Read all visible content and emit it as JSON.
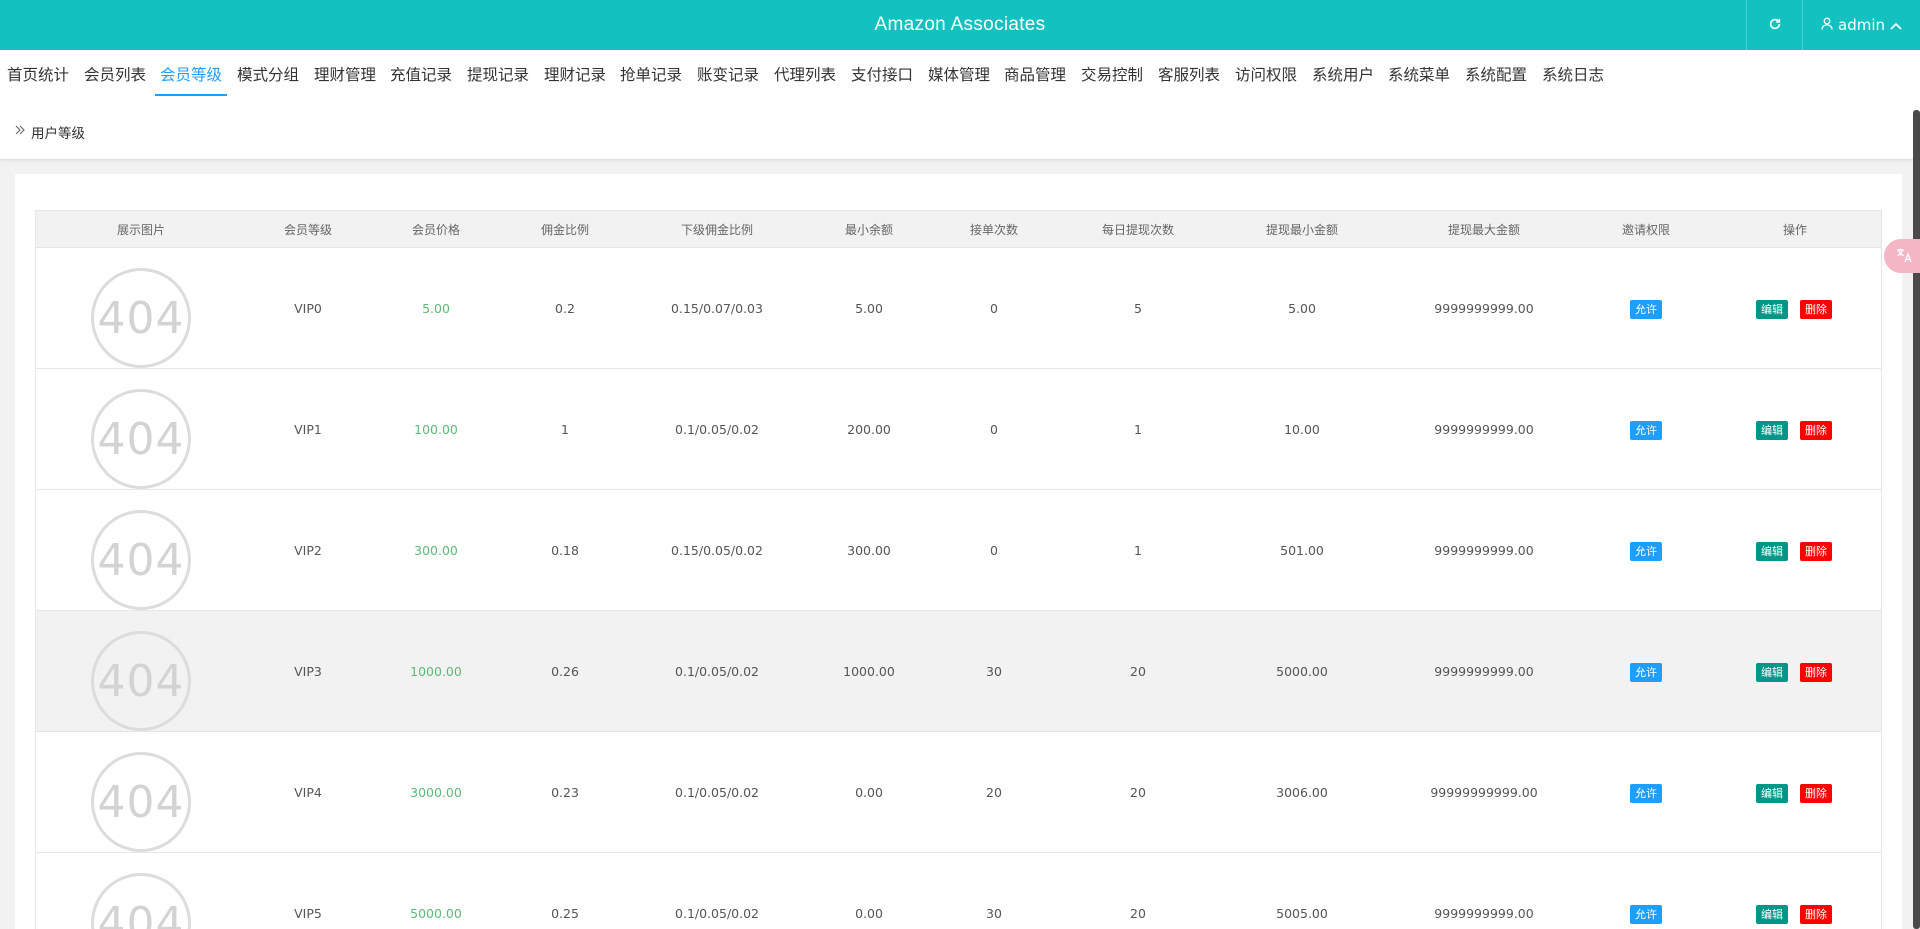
{
  "header": {
    "title": "Amazon Associates",
    "user": "admin",
    "brand_color": "#13c1c1"
  },
  "nav": {
    "tabs": [
      "首页统计",
      "会员列表",
      "会员等级",
      "模式分组",
      "理财管理",
      "充值记录",
      "提现记录",
      "理财记录",
      "抢单记录",
      "账变记录",
      "代理列表",
      "支付接口",
      "媒体管理",
      "商品管理",
      "交易控制",
      "客服列表",
      "访问权限",
      "系统用户",
      "系统菜单",
      "系统配置",
      "系统日志"
    ],
    "active": "会员等级"
  },
  "breadcrumb": {
    "label": "用户等级"
  },
  "table": {
    "headers": [
      "展示图片",
      "会员等级",
      "会员价格",
      "佣金比例",
      "下级佣金比例",
      "最小余额",
      "接单次数",
      "每日提现次数",
      "提现最小金额",
      "提现最大金额",
      "邀请权限",
      "操作"
    ],
    "image_placeholder": "404",
    "rows": [
      {
        "level": "VIP0",
        "price": "5.00",
        "commission": "0.2",
        "sub_commission": "0.15/0.07/0.03",
        "min_balance": "5.00",
        "orders": "0",
        "withdraw_times": "5",
        "withdraw_min": "5.00",
        "withdraw_max": "9999999999.00",
        "invite": "允许"
      },
      {
        "level": "VIP1",
        "price": "100.00",
        "commission": "1",
        "sub_commission": "0.1/0.05/0.02",
        "min_balance": "200.00",
        "orders": "0",
        "withdraw_times": "1",
        "withdraw_min": "10.00",
        "withdraw_max": "9999999999.00",
        "invite": "允许"
      },
      {
        "level": "VIP2",
        "price": "300.00",
        "commission": "0.18",
        "sub_commission": "0.15/0.05/0.02",
        "min_balance": "300.00",
        "orders": "0",
        "withdraw_times": "1",
        "withdraw_min": "501.00",
        "withdraw_max": "9999999999.00",
        "invite": "允许"
      },
      {
        "level": "VIP3",
        "price": "1000.00",
        "commission": "0.26",
        "sub_commission": "0.1/0.05/0.02",
        "min_balance": "1000.00",
        "orders": "30",
        "withdraw_times": "20",
        "withdraw_min": "5000.00",
        "withdraw_max": "9999999999.00",
        "invite": "允许"
      },
      {
        "level": "VIP4",
        "price": "3000.00",
        "commission": "0.23",
        "sub_commission": "0.1/0.05/0.02",
        "min_balance": "0.00",
        "orders": "20",
        "withdraw_times": "20",
        "withdraw_min": "3006.00",
        "withdraw_max": "99999999999.00",
        "invite": "允许"
      },
      {
        "level": "VIP5",
        "price": "5000.00",
        "commission": "0.25",
        "sub_commission": "0.1/0.05/0.02",
        "min_balance": "0.00",
        "orders": "30",
        "withdraw_times": "20",
        "withdraw_min": "5005.00",
        "withdraw_max": "9999999999.00",
        "invite": "允许"
      }
    ],
    "actions": {
      "edit": "编辑",
      "delete": "删除"
    }
  },
  "colors": {
    "accent": "#1e9fff",
    "edit": "#009688",
    "delete": "#ff0000",
    "price": "#5fb878"
  },
  "icons": {
    "refresh": "refresh-icon",
    "user": "user-icon",
    "chevron": "chevron-up-icon",
    "breadcrumb": "double-chevron-right-icon",
    "translate": "translate-icon"
  }
}
